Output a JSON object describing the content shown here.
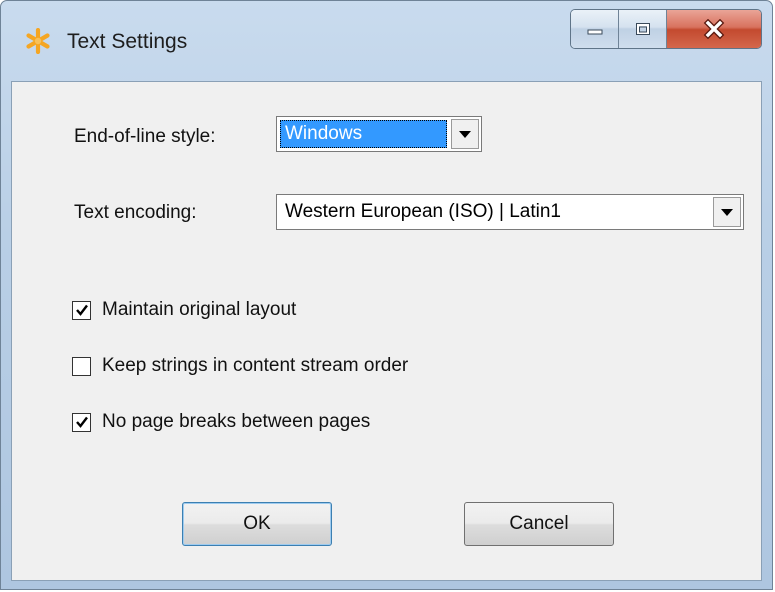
{
  "window": {
    "title": "Text Settings",
    "icon": "asterisk-icon",
    "caption_icons": [
      "minimize-icon",
      "maximize-icon",
      "close-icon"
    ]
  },
  "fields": {
    "eol_label": "End-of-line style:",
    "eol_value": "Windows",
    "encoding_label": "Text encoding:",
    "encoding_value": "Western European (ISO) | Latin1"
  },
  "options": [
    {
      "label": "Maintain original layout",
      "checked": true
    },
    {
      "label": "Keep strings in content stream order",
      "checked": false
    },
    {
      "label": "No page breaks between pages",
      "checked": true
    }
  ],
  "buttons": {
    "ok_label": "OK",
    "cancel_label": "Cancel"
  },
  "colors": {
    "selection": "#3399ff",
    "close_button": "#c34a2f",
    "app_icon": "#f5a623"
  }
}
